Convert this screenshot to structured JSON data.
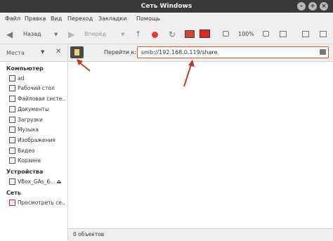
{
  "window": {
    "title": "Сеть Windows"
  },
  "menubar": [
    "Файл",
    "Правка",
    "Вид",
    "Переход",
    "Закладки",
    "Помощь"
  ],
  "toolbar": {
    "back_label": "Назад",
    "forward_label": "Вперёд",
    "zoom_label": "100%"
  },
  "sidebar": {
    "header": "Места",
    "sections": [
      {
        "title": "Компьютер",
        "items": [
          {
            "label": "ad",
            "icon": "home-icon"
          },
          {
            "label": "Рабочий стол",
            "icon": "desktop-folder-icon"
          },
          {
            "label": "Файловая систе...",
            "icon": "filesystem-icon"
          },
          {
            "label": "Документы",
            "icon": "documents-folder-icon"
          },
          {
            "label": "Загрузки",
            "icon": "downloads-folder-icon"
          },
          {
            "label": "Музыка",
            "icon": "music-folder-icon"
          },
          {
            "label": "Изображения",
            "icon": "pictures-folder-icon"
          },
          {
            "label": "Видео",
            "icon": "videos-folder-icon"
          },
          {
            "label": "Корзина",
            "icon": "trash-icon"
          }
        ]
      },
      {
        "title": "Устройства",
        "items": [
          {
            "label": "VBox_GAs_6...",
            "icon": "cdrom-icon"
          }
        ]
      },
      {
        "title": "Сеть",
        "items": [
          {
            "label": "Просмотреть се...",
            "icon": "network-icon"
          }
        ]
      }
    ]
  },
  "location": {
    "label": "Перейти к:",
    "value": "smb://192.168.0.119/share"
  },
  "status": {
    "text": "0 объектов"
  },
  "colors": {
    "accent": "#e95420",
    "annotation": "#c0392b"
  }
}
